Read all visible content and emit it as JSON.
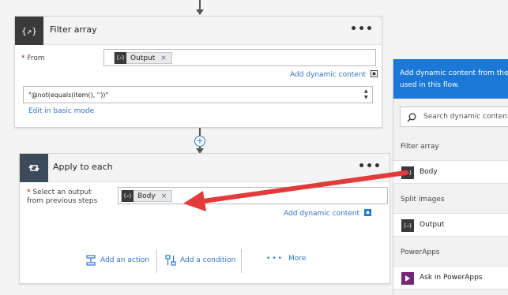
{
  "filter_card": {
    "title": "Filter array",
    "menu": "•••",
    "icon": "{↗}",
    "from_label": "From",
    "required_mark": "*",
    "token_label": "Output",
    "token_remove": "×",
    "add_dynamic": "Add dynamic content",
    "expression": "\"@not(equals(item(), ''))\"",
    "edit_basic": "Edit in basic mode"
  },
  "apply_card": {
    "title": "Apply to each",
    "menu": "•••",
    "select_label_line1": "Select an output",
    "select_label_line2": "from previous steps",
    "required_mark": "*",
    "token_label": "Body",
    "token_remove": "×",
    "add_dynamic": "Add dynamic content",
    "add_action": "Add an action",
    "add_condition": "Add a condition",
    "more": "More"
  },
  "connector": {
    "plus": "+"
  },
  "panel": {
    "header_line1": "Add dynamic content from the",
    "header_line2": "used in this flow.",
    "search_placeholder": "Search dynamic conten",
    "sections": [
      {
        "title": "Filter array",
        "item": "Body"
      },
      {
        "title": "Split images",
        "item": "Output"
      },
      {
        "title": "PowerApps",
        "item": "Ask in PowerApps"
      }
    ]
  },
  "colors": {
    "accent": "#2f73c8",
    "panel_header": "#1b78d6",
    "filter_icon_bg": "#3a3a3a",
    "apply_icon_bg": "#3c4a5a",
    "powerapps_icon_bg": "#742774",
    "arrow": "#e23b3b"
  },
  "icons": {
    "filter": "filter-array-icon",
    "loop": "loop-icon",
    "search": "search-icon",
    "add_action": "add-action-icon",
    "add_condition": "condition-icon",
    "more": "ellipsis-icon"
  }
}
